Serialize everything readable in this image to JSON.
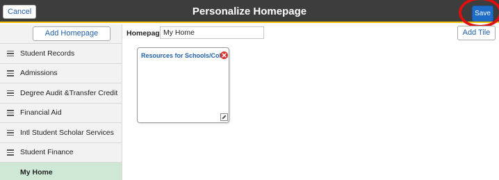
{
  "header": {
    "title": "Personalize Homepage",
    "cancel_label": "Cancel",
    "save_label": "Save",
    "highlight_color": "#e01010"
  },
  "sidebar": {
    "add_homepage_label": "Add Homepage",
    "items": [
      {
        "label": "Student Records"
      },
      {
        "label": "Admissions"
      },
      {
        "label": "Degree Audit &Transfer Credit"
      },
      {
        "label": "Financial Aid"
      },
      {
        "label": "Intl Student Scholar Services"
      },
      {
        "label": "Student Finance"
      },
      {
        "label": "My Home",
        "active": true
      }
    ]
  },
  "homepage": {
    "label": "Homepage",
    "value": "My Home",
    "add_tile_label": "Add Tile"
  },
  "tiles": [
    {
      "title": "Resources for Schools/Coll...",
      "remove_icon": "remove-icon",
      "edit_icon": "edit-icon"
    }
  ],
  "colors": {
    "header_bg": "#3d3d3d",
    "accent": "#1e6cc8",
    "active_nav": "#cfe8d6",
    "link": "#1f5fa8"
  }
}
